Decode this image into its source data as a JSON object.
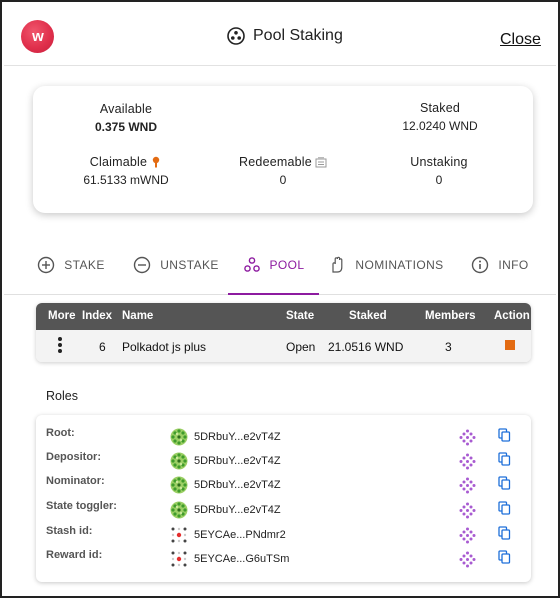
{
  "header": {
    "logo_letter": "w",
    "title": "Pool Staking",
    "close_label": "Close"
  },
  "balances": {
    "available": {
      "label": "Available",
      "value": "0.375 WND"
    },
    "staked": {
      "label": "Staked",
      "value": "12.0240 WND"
    },
    "claimable": {
      "label": "Claimable",
      "value": "61.5133 mWND"
    },
    "redeemable": {
      "label": "Redeemable",
      "value": "0"
    },
    "unstaking": {
      "label": "Unstaking",
      "value": "0"
    }
  },
  "tabs": [
    {
      "label": "STAKE",
      "icon": "add-circle-icon"
    },
    {
      "label": "UNSTAKE",
      "icon": "remove-circle-icon"
    },
    {
      "label": "POOL",
      "icon": "pool-icon",
      "active": true
    },
    {
      "label": "NOMINATIONS",
      "icon": "hand-icon"
    },
    {
      "label": "INFO",
      "icon": "info-icon"
    }
  ],
  "table": {
    "headers": [
      "More",
      "Index",
      "Name",
      "State",
      "Staked",
      "Members",
      "Action"
    ],
    "row": {
      "index": "6",
      "name": "Polkadot js plus",
      "state": "Open",
      "staked": "21.0516 WND",
      "members": "3"
    }
  },
  "roles": {
    "title": "Roles",
    "items": [
      {
        "label": "Root:",
        "address": "5DRbuY...e2vT4Z",
        "identicon": "green-identicon"
      },
      {
        "label": "Depositor:",
        "address": "5DRbuY...e2vT4Z",
        "identicon": "green-identicon"
      },
      {
        "label": "Nominator:",
        "address": "5DRbuY...e2vT4Z",
        "identicon": "green-identicon"
      },
      {
        "label": "State toggler:",
        "address": "5DRbuY...e2vT4Z",
        "identicon": "green-identicon"
      },
      {
        "label": "Stash id:",
        "address": "5EYCAe...PNdmr2",
        "identicon": "red-dots-identicon"
      },
      {
        "label": "Reward id:",
        "address": "5EYCAe...G6uTSm",
        "identicon": "red-dots-identicon"
      }
    ]
  },
  "colors": {
    "accent": "#8d1ba0",
    "action": "#e36b12",
    "table_header": "#555555",
    "copy_icon": "#1e6fd9",
    "subscan_icon": "#a85bd1"
  }
}
